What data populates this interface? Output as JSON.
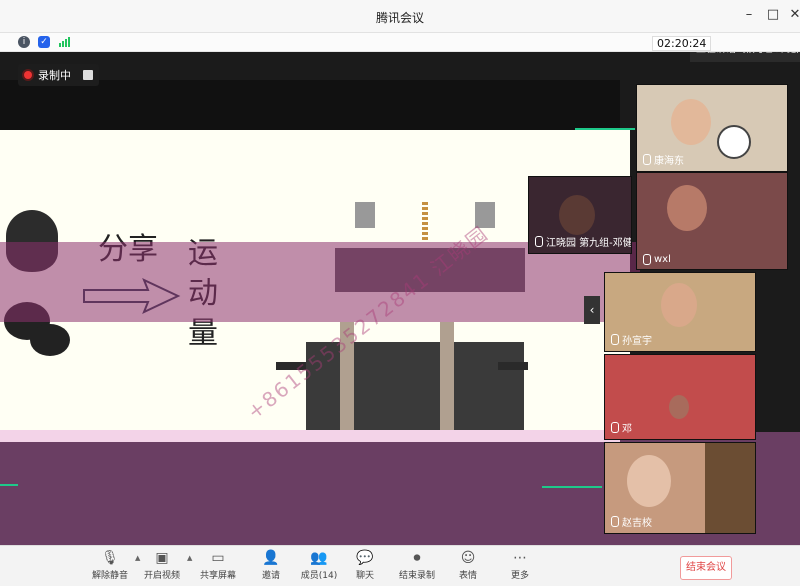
{
  "window": {
    "title": "腾讯会议",
    "min_glyph": "–",
    "max_glyph": "□",
    "close_glyph": "✕"
  },
  "infobar": {
    "timer": "02:20:24"
  },
  "stage": {
    "recording_label": "录制中",
    "speaking_label": "正在讲话: 第九组-邓健;",
    "slide_text_share": "分享",
    "slide_text_momentum": "运动量",
    "watermark_text": "+86155535272841 江晓园"
  },
  "participants": [
    {
      "name": "康海东"
    },
    {
      "name": "wxl"
    },
    {
      "name": "江晓园 第九组-邓健"
    },
    {
      "name": "孙宣宇"
    },
    {
      "name": "邓"
    },
    {
      "name": "赵吉校"
    }
  ],
  "toolbar": {
    "items": [
      {
        "label": "解除静音",
        "icon": "mic-icon"
      },
      {
        "label": "开启视频",
        "icon": "camera-icon"
      },
      {
        "label": "共享屏幕",
        "icon": "screen-share-icon"
      },
      {
        "label": "邀请",
        "icon": "invite-icon"
      },
      {
        "label": "成员(14)",
        "icon": "members-icon"
      },
      {
        "label": "聊天",
        "icon": "chat-icon"
      },
      {
        "label": "结束录制",
        "icon": "record-stop-icon"
      },
      {
        "label": "表情",
        "icon": "emoji-icon"
      },
      {
        "label": "更多",
        "icon": "more-icon"
      }
    ],
    "end_label": "结束会议"
  },
  "colors": {
    "slide_bg": "#fffff4",
    "magenta_band": "#8c326e",
    "accent_green": "#1ec98a",
    "end_red": "#e04646"
  }
}
